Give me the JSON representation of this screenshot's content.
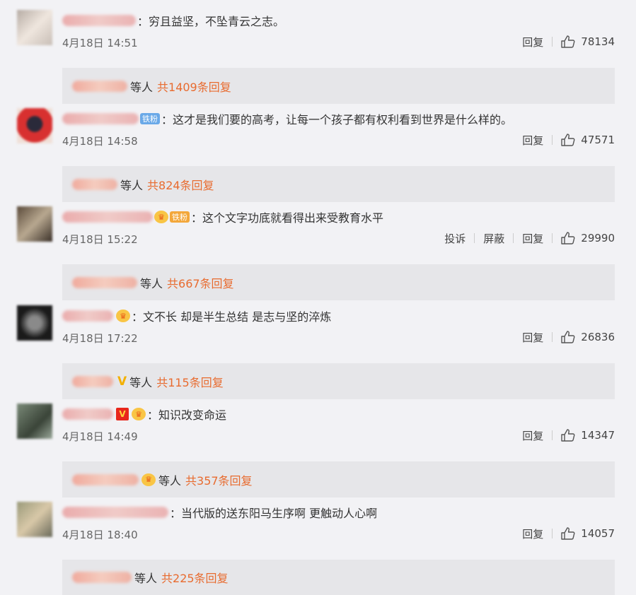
{
  "comments": [
    {
      "text": "穷且益坚，不坠青云之志。",
      "time": "4月18日 14:51",
      "actions": [
        "回复"
      ],
      "likes": "78134",
      "reply": {
        "label": "等人",
        "count": "共1409条回复"
      }
    },
    {
      "badge": "铁粉",
      "text": "这才是我们要的高考，让每一个孩子都有权利看到世界是什么样的。",
      "time": "4月18日 14:58",
      "actions": [
        "回复"
      ],
      "likes": "47571",
      "reply": {
        "label": "等人",
        "count": "共824条回复"
      }
    },
    {
      "badge": "铁粉",
      "text": "这个文字功底就看得出来受教育水平",
      "time": "4月18日 15:22",
      "actions": [
        "投诉",
        "屏蔽",
        "回复"
      ],
      "likes": "29990",
      "reply": {
        "label": "等人",
        "count": "共667条回复"
      }
    },
    {
      "text": "文不长 却是半生总结 是志与坚的淬炼",
      "time": "4月18日 17:22",
      "actions": [
        "回复"
      ],
      "likes": "26836",
      "reply": {
        "label": "等人",
        "count": "共115条回复"
      }
    },
    {
      "text": "知识改变命运",
      "time": "4月18日 14:49",
      "actions": [
        "回复"
      ],
      "likes": "14347",
      "reply": {
        "label": "等人",
        "count": "共357条回复"
      }
    },
    {
      "text": "当代版的送东阳马生序啊 更触动人心啊",
      "time": "4月18日 18:40",
      "actions": [
        "回复"
      ],
      "likes": "14057",
      "reply": {
        "label": "等人",
        "count": "共225条回复"
      }
    }
  ],
  "colors": {
    "accent": "#e86b2f",
    "badge": "#6aa9e8",
    "background": "#f2f2f5",
    "reply_bg": "#e6e6e9"
  },
  "icons": {
    "like": "thumbs-up-icon",
    "crown": "crown-icon",
    "vip": "vip-v-icon"
  }
}
